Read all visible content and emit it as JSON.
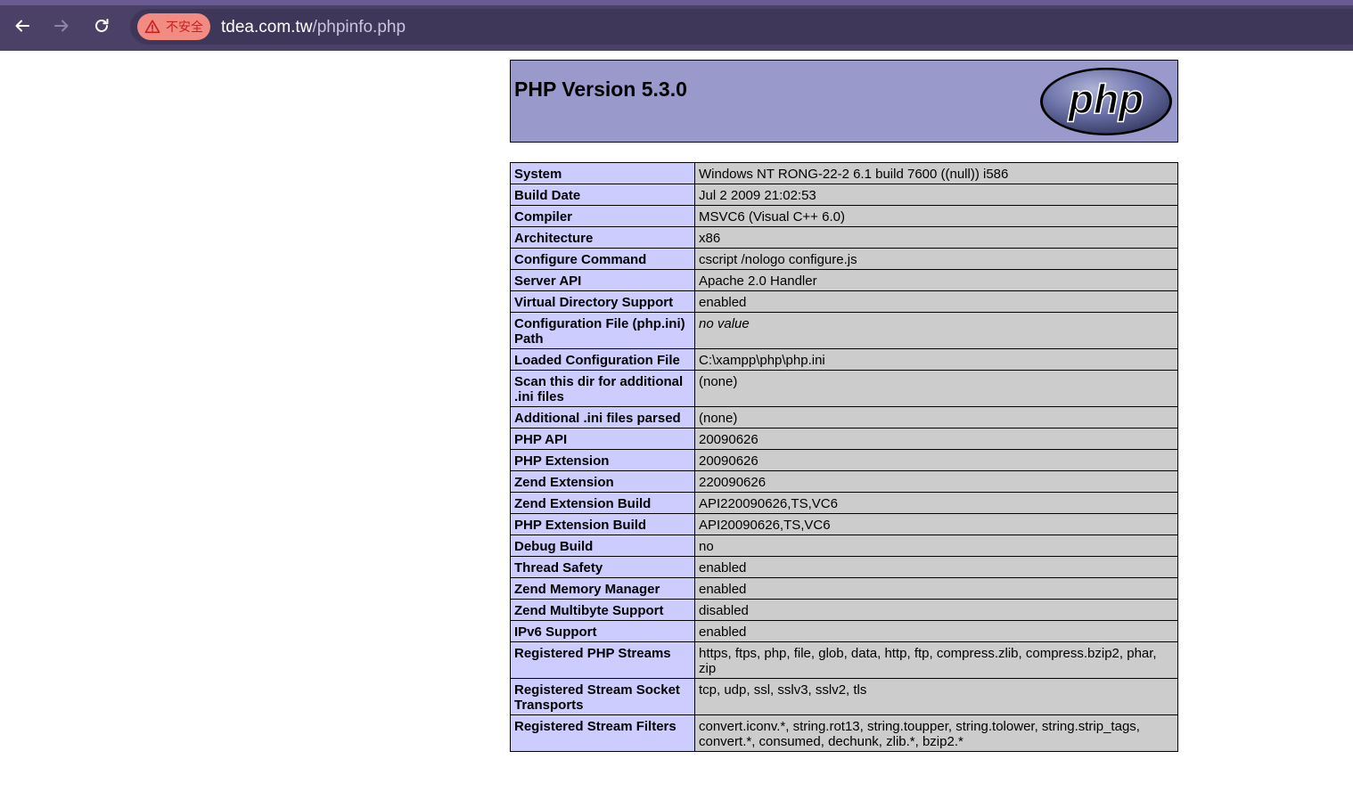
{
  "browser": {
    "security_label": "不安全",
    "url_domain": "tdea.com.tw",
    "url_path": "/phpinfo.php",
    "colors": {
      "toolbar": "#4b4166",
      "omnibox": "#3f3759",
      "chip": "#f28b82"
    }
  },
  "page": {
    "title": "PHP Version 5.3.0",
    "logo_text": "php",
    "colors": {
      "header": "#9999cc",
      "key_cell": "#ccccff",
      "value_cell": "#cccccc"
    },
    "rows": [
      {
        "key": "System",
        "value": "Windows NT RONG-22-2 6.1 build 7600 ((null)) i586"
      },
      {
        "key": "Build Date",
        "value": "Jul 2 2009 21:02:53"
      },
      {
        "key": "Compiler",
        "value": "MSVC6 (Visual C++ 6.0)"
      },
      {
        "key": "Architecture",
        "value": "x86"
      },
      {
        "key": "Configure Command",
        "value": "cscript /nologo configure.js"
      },
      {
        "key": "Server API",
        "value": "Apache 2.0 Handler"
      },
      {
        "key": "Virtual Directory Support",
        "value": "enabled"
      },
      {
        "key": "Configuration File (php.ini) Path",
        "value": "no value",
        "italic": true
      },
      {
        "key": "Loaded Configuration File",
        "value": "C:\\xampp\\php\\php.ini"
      },
      {
        "key": "Scan this dir for additional .ini files",
        "value": "(none)"
      },
      {
        "key": "Additional .ini files parsed",
        "value": "(none)"
      },
      {
        "key": "PHP API",
        "value": "20090626"
      },
      {
        "key": "PHP Extension",
        "value": "20090626"
      },
      {
        "key": "Zend Extension",
        "value": "220090626"
      },
      {
        "key": "Zend Extension Build",
        "value": "API220090626,TS,VC6"
      },
      {
        "key": "PHP Extension Build",
        "value": "API20090626,TS,VC6"
      },
      {
        "key": "Debug Build",
        "value": "no"
      },
      {
        "key": "Thread Safety",
        "value": "enabled"
      },
      {
        "key": "Zend Memory Manager",
        "value": "enabled"
      },
      {
        "key": "Zend Multibyte Support",
        "value": "disabled"
      },
      {
        "key": "IPv6 Support",
        "value": "enabled"
      },
      {
        "key": "Registered PHP Streams",
        "value": "https, ftps, php, file, glob, data, http, ftp, compress.zlib, compress.bzip2, phar, zip"
      },
      {
        "key": "Registered Stream Socket Transports",
        "value": "tcp, udp, ssl, sslv3, sslv2, tls"
      },
      {
        "key": "Registered Stream Filters",
        "value": "convert.iconv.*, string.rot13, string.toupper, string.tolower, string.strip_tags, convert.*, consumed, dechunk, zlib.*, bzip2.*"
      }
    ]
  }
}
